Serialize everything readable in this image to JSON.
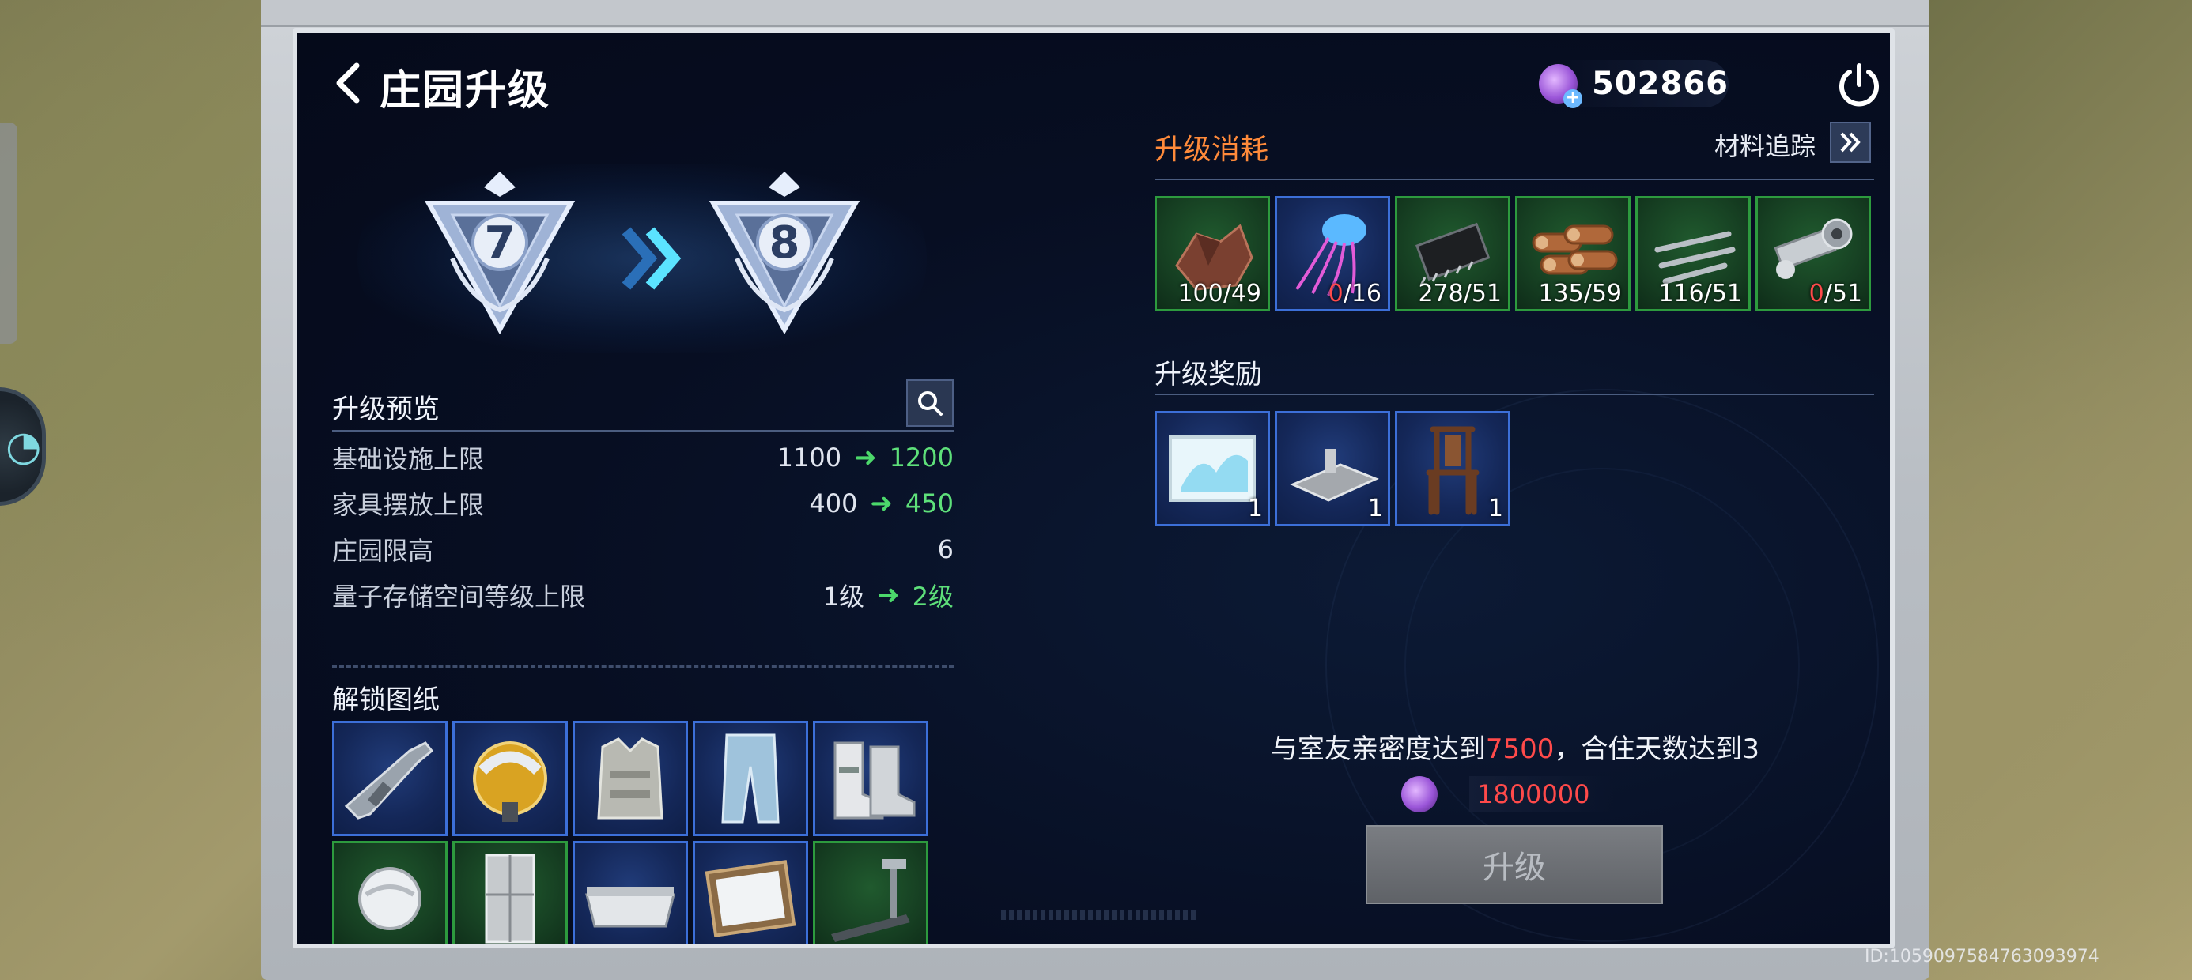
{
  "header": {
    "title": "庄园升级",
    "currency_value": "502866"
  },
  "levels": {
    "current": "7",
    "next": "8"
  },
  "preview": {
    "title": "升级预览",
    "stats": [
      {
        "label": "基础设施上限",
        "old": "1100",
        "new": "1200"
      },
      {
        "label": "家具摆放上限",
        "old": "400",
        "new": "450"
      },
      {
        "label": "庄园限高",
        "value": "6"
      },
      {
        "label": "量子存储空间等级上限",
        "old": "1级",
        "new": "2级"
      }
    ]
  },
  "blueprints": {
    "title": "解锁图纸",
    "items": [
      {
        "icon": "rifle-icon",
        "rarity": "blue"
      },
      {
        "icon": "helmet-icon",
        "rarity": "blue"
      },
      {
        "icon": "armor-vest-icon",
        "rarity": "blue"
      },
      {
        "icon": "pants-icon",
        "rarity": "blue"
      },
      {
        "icon": "boots-icon",
        "rarity": "blue"
      },
      {
        "icon": "bowl-icon",
        "rarity": "green"
      },
      {
        "icon": "fridge-icon",
        "rarity": "green"
      },
      {
        "icon": "bathtub-icon",
        "rarity": "blue"
      },
      {
        "icon": "mirror-frame-icon",
        "rarity": "blue"
      },
      {
        "icon": "treadmill-icon",
        "rarity": "green"
      }
    ]
  },
  "cost": {
    "title": "升级消耗",
    "track_label": "材料追踪",
    "materials": [
      {
        "icon": "copper-ore-icon",
        "have": "100",
        "need": "49",
        "enough": true,
        "rarity": "green"
      },
      {
        "icon": "jellyfish-icon",
        "have": "0",
        "need": "16",
        "enough": false,
        "rarity": "blue"
      },
      {
        "icon": "chip-icon",
        "have": "278",
        "need": "51",
        "enough": true,
        "rarity": "green"
      },
      {
        "icon": "wood-logs-icon",
        "have": "135",
        "need": "59",
        "enough": true,
        "rarity": "green"
      },
      {
        "icon": "metal-rods-icon",
        "have": "116",
        "need": "51",
        "enough": true,
        "rarity": "green"
      },
      {
        "icon": "gear-parts-icon",
        "have": "0",
        "need": "51",
        "enough": false,
        "rarity": "green"
      }
    ]
  },
  "reward": {
    "title": "升级奖励",
    "items": [
      {
        "icon": "painting-icon",
        "qty": "1"
      },
      {
        "icon": "platform-icon",
        "qty": "1"
      },
      {
        "icon": "chair-icon",
        "qty": "1"
      }
    ]
  },
  "requirement": {
    "prefix": "与室友亲密度达到",
    "highlight": "7500",
    "suffix": "，合住天数达到3",
    "cost_value": "1800000"
  },
  "upgrade_button": "升级",
  "id_text": "ID:1059097584763093974",
  "colors": {
    "accent_orange": "#ff8a3a",
    "increase_green": "#5ee07a",
    "warning_red": "#ff4a4a",
    "rarity_blue": "#3c6fd8",
    "rarity_green": "#2d9a3e"
  }
}
